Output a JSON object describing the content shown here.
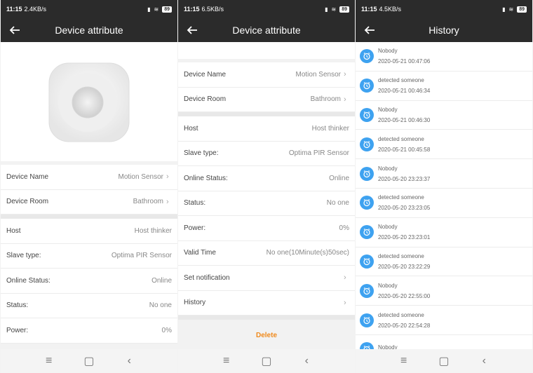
{
  "status_bars": [
    {
      "time": "11:15",
      "speed": "2.4KB/s",
      "battery": "89"
    },
    {
      "time": "11:15",
      "speed": "6.5KB/s",
      "battery": "89"
    },
    {
      "time": "11:15",
      "speed": "4.5KB/s",
      "battery": "89"
    }
  ],
  "screen1": {
    "title": "Device attribute",
    "rows_a": [
      {
        "label": "Device Name",
        "value": "Motion Sensor"
      },
      {
        "label": "Device Room",
        "value": "Bathroom"
      }
    ],
    "rows_b": [
      {
        "label": "Host",
        "value": "Host thinker"
      },
      {
        "label": "Slave type:",
        "value": "Optima PIR Sensor"
      },
      {
        "label": "Online Status:",
        "value": "Online"
      },
      {
        "label": "Status:",
        "value": "No one"
      },
      {
        "label": "Power:",
        "value": "0%"
      }
    ]
  },
  "screen2": {
    "title": "Device attribute",
    "rows_a": [
      {
        "label": "Device Name",
        "value": "Motion Sensor"
      },
      {
        "label": "Device Room",
        "value": "Bathroom"
      }
    ],
    "rows_b": [
      {
        "label": "Host",
        "value": "Host thinker"
      },
      {
        "label": "Slave type:",
        "value": "Optima PIR Sensor"
      },
      {
        "label": "Online Status:",
        "value": "Online"
      },
      {
        "label": "Status:",
        "value": "No one"
      },
      {
        "label": "Power:",
        "value": "0%"
      },
      {
        "label": "Valid Time",
        "value": "No one(10Minute(s)50sec)"
      },
      {
        "label": "Set notification",
        "value": ""
      },
      {
        "label": "History",
        "value": ""
      }
    ],
    "delete_label": "Delete"
  },
  "screen3": {
    "title": "History",
    "items": [
      {
        "status": "Nobody",
        "time": "2020-05-21 00:47:06"
      },
      {
        "status": "detected someone",
        "time": "2020-05-21 00:46:34"
      },
      {
        "status": "Nobody",
        "time": "2020-05-21 00:46:30"
      },
      {
        "status": "detected someone",
        "time": "2020-05-21 00:45:58"
      },
      {
        "status": "Nobody",
        "time": "2020-05-20 23:23:37"
      },
      {
        "status": "detected someone",
        "time": "2020-05-20 23:23:05"
      },
      {
        "status": "Nobody",
        "time": "2020-05-20 23:23:01"
      },
      {
        "status": "detected someone",
        "time": "2020-05-20 23:22:29"
      },
      {
        "status": "Nobody",
        "time": "2020-05-20 22:55:00"
      },
      {
        "status": "detected someone",
        "time": "2020-05-20 22:54:28"
      },
      {
        "status": "Nobody",
        "time": ""
      }
    ]
  },
  "icons": {
    "back": "back-arrow-icon",
    "clock": "alarm-clock-icon",
    "chevron": "chevron-right-icon"
  },
  "colors": {
    "header": "#2b2b2b",
    "accent": "#3ea2f0",
    "delete": "#f08a1c"
  }
}
